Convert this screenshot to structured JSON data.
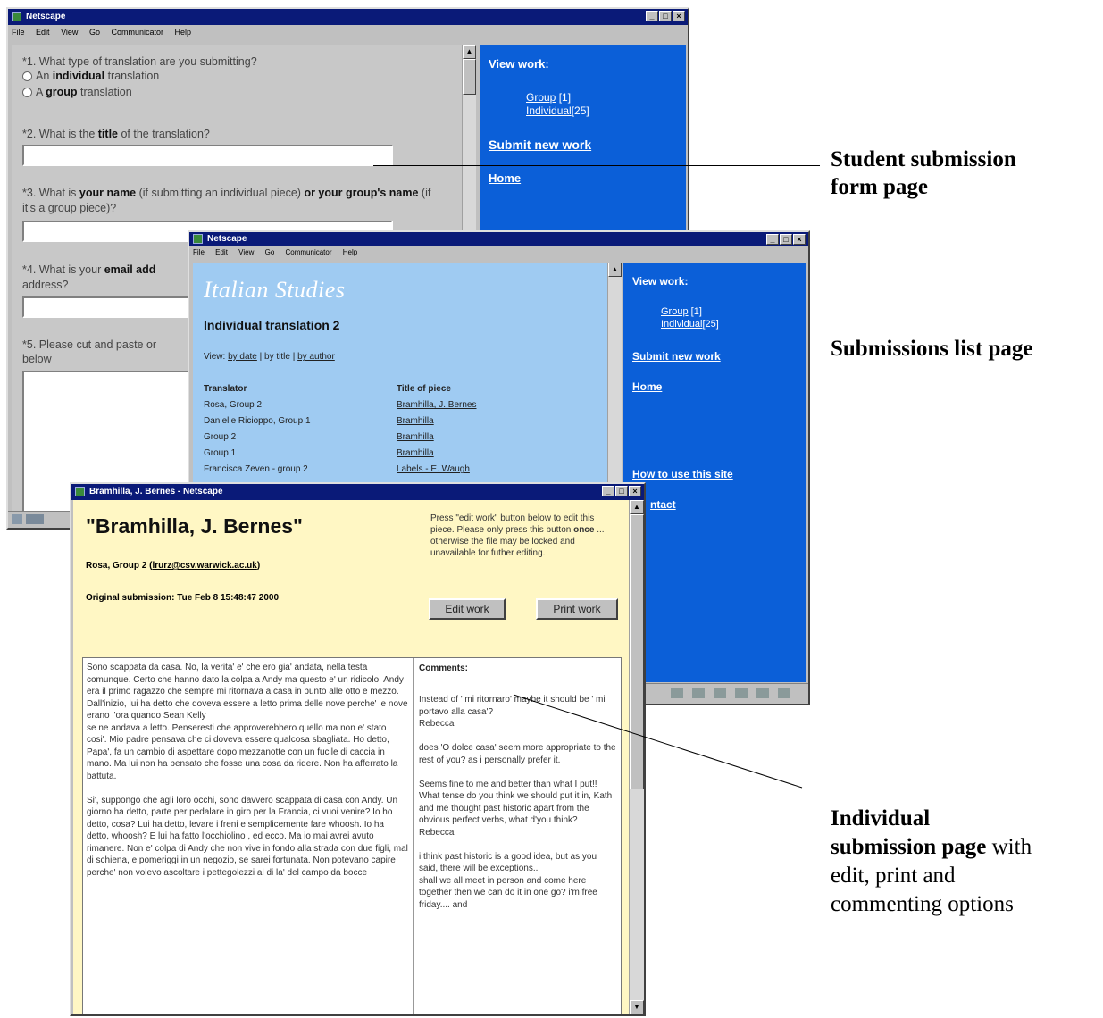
{
  "browser": {
    "window_title": "Netscape",
    "menu": [
      "File",
      "Edit",
      "View",
      "Go",
      "Communicator",
      "Help"
    ]
  },
  "nav": {
    "view_work": "View work:",
    "group_link": "Group",
    "group_count": "[1]",
    "individual_link": "Individual",
    "individual_count": "[25]",
    "submit_new_work": "Submit new work",
    "home": "Home",
    "how_to_use": "How to use this site",
    "contact_partial": "ntact"
  },
  "form_page": {
    "q1": "*1. What type of translation are you submitting?",
    "q1_opt1_pre": "An ",
    "q1_opt1_bold": "individual",
    "q1_opt1_post": " translation",
    "q1_opt2_pre": "A ",
    "q1_opt2_bold": "group",
    "q1_opt2_post": " translation",
    "q2_pre": "*2. What is the ",
    "q2_bold": "title",
    "q2_post": " of the translation?",
    "q3_pre": "*3. What is ",
    "q3_bold1": "your name",
    "q3_mid": " (if submitting an individual piece) ",
    "q3_bold2": "or your group's name",
    "q3_post": " (if it's a group piece)?",
    "q4_pre": "*4. What is your ",
    "q4_bold": "email add",
    "q4_line2": "address?",
    "q5_line1": "*5. Please cut and paste or",
    "q5_line2": "below"
  },
  "list_page": {
    "site_title": "Italian Studies",
    "heading": "Individual translation 2",
    "view_prefix": "View: ",
    "view_by_date": "by date",
    "view_by_title": " | by title | ",
    "view_by_author": "by author",
    "col_translator": "Translator",
    "col_title": "Title of piece",
    "rows": [
      {
        "translator": "Rosa, Group 2",
        "title": "Bramhilla, J. Bernes"
      },
      {
        "translator": "Danielle Ricioppo, Group 1",
        "title": "Bramhilla"
      },
      {
        "translator": "Group 2",
        "title": "Bramhilla"
      },
      {
        "translator": "Group 1",
        "title": "Bramhilla"
      },
      {
        "translator": "Francisca Zeven - group 2",
        "title": "Labels - E. Waugh"
      }
    ]
  },
  "detail_page": {
    "window_title": "Bramhilla, J. Bernes - Netscape",
    "heading": "\"Bramhilla, J. Bernes\"",
    "author": "Rosa, Group 2 (",
    "email": "lrurz@csv.warwick.ac.uk",
    "author_close": ")",
    "original_submission": "Original submission: Tue Feb 8 15:48:47 2000",
    "instructions_pre": "Press \"edit work\" button below to edit this piece. Please only press this button ",
    "instructions_bold": "once",
    "instructions_post": " ... otherwise the file may be locked and unavailable for futher editing.",
    "edit_button": "Edit work",
    "print_button": "Print work",
    "body_text": "Sono scappata da casa. No, la verita' e' che ero gia' andata, nella testa comunque. Certo che hanno dato la colpa a Andy ma questo e' un ridicolo. Andy era il primo ragazzo che sempre mi ritornava a casa in punto alle otto e mezzo. Dall'inizio, lui ha detto che doveva essere a letto prima delle nove perche' le nove erano l'ora quando Sean Kelly\nse ne andava a letto. Penseresti che approverebbero quello ma non e' stato cosi'. Mio padre pensava che ci doveva essere qualcosa sbagliata. Ho detto, Papa', fa un cambio di aspettare dopo mezzanotte con un fucile di caccia in mano. Ma lui non ha pensato che fosse una cosa da ridere. Non ha afferrato la battuta.\n\nSi', suppongo che agli loro occhi, sono davvero scappata di casa con Andy. Un giorno ha detto, parte per pedalare in giro per la Francia, ci vuoi venire? Io ho detto, cosa? Lui ha detto, levare i freni e semplicemente fare whoosh. Io ha detto, whoosh? E lui ha fatto l'occhiolino , ed ecco. Ma io mai avrei avuto rimanere. Non e' colpa di Andy che non vive in fondo alla strada con due figli, mal di schiena, e pomeriggi in un negozio, se sarei fortunata. Non potevano capire perche' non volevo ascoltare i pettegolezzi al di la' del campo da bocce",
    "comments_title": "Comments:",
    "comments_text": "Instead of ' mi ritornaro' maybe it should be ' mi portavo alla casa'?\nRebecca\n\ndoes 'O dolce casa' seem more appropriate to the rest of you? as i personally prefer it.\n\nSeems fine to me and better than what I put!! What tense do you think we should put it in, Kath and me thought past historic apart from the obvious perfect verbs, what d'you think?\nRebecca\n\ni think past historic is a good idea, but as you said, there will be exceptions..\nshall we all meet in person and come here together then we can do it in one go? i'm free friday.... and"
  },
  "callouts": {
    "form_line1": "Student submission",
    "form_line2": "form page",
    "list": "Submissions list page",
    "detail_bold1": "Individual",
    "detail_bold2": "submission page",
    "detail_rest1": " with",
    "detail_rest2": "edit, print and",
    "detail_rest3": "commenting options"
  }
}
